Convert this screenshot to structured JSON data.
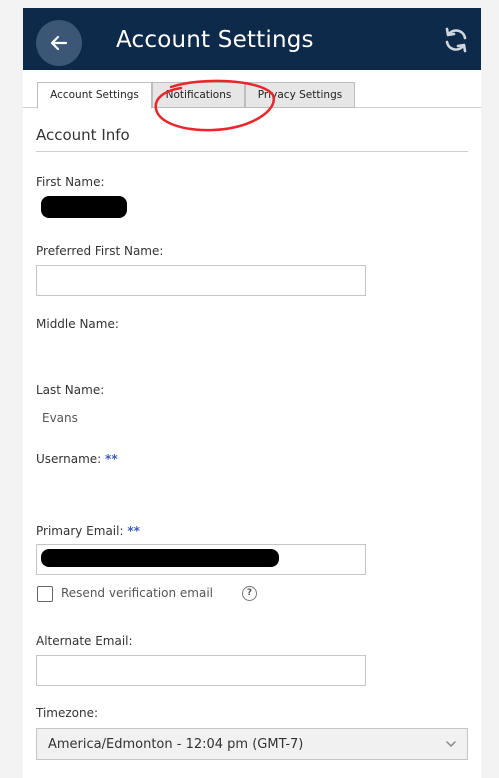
{
  "header": {
    "title": "Account Settings",
    "back_icon": "arrow-left-icon",
    "refresh_icon": "refresh-icon",
    "bg_color": "#0e2a4a"
  },
  "tabs": [
    {
      "label": "Account Settings",
      "active": true
    },
    {
      "label": "Notifications",
      "active": false
    },
    {
      "label": "Privacy Settings",
      "active": false
    }
  ],
  "section": {
    "title": "Account Info"
  },
  "fields": {
    "first_name": {
      "label": "First Name:"
    },
    "preferred_first_name": {
      "label": "Preferred First Name:",
      "value": ""
    },
    "middle_name": {
      "label": "Middle Name:"
    },
    "last_name": {
      "label": "Last Name:",
      "value": "Evans"
    },
    "username": {
      "label": "Username:",
      "required_marker": "**"
    },
    "primary_email": {
      "label": "Primary Email:",
      "required_marker": "**"
    },
    "resend_verification": {
      "label": "Resend verification email",
      "help_glyph": "?"
    },
    "alternate_email": {
      "label": "Alternate Email:",
      "value": ""
    },
    "timezone": {
      "label": "Timezone:",
      "selected": "America/Edmonton - 12:04 pm (GMT-7)"
    }
  },
  "annotation_color": "#e8262b"
}
